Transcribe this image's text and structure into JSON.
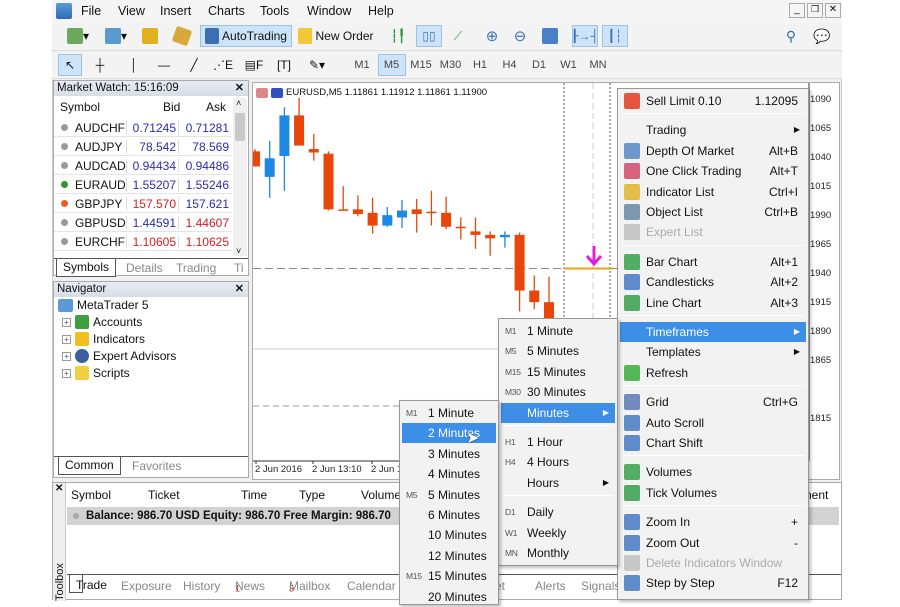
{
  "menubar": {
    "items": [
      "File",
      "View",
      "Insert",
      "Charts",
      "Tools",
      "Window",
      "Help"
    ]
  },
  "toolbar": {
    "autotrading": "AutoTrading",
    "new_order": "New Order",
    "timeframes": [
      "M1",
      "M5",
      "M15",
      "M30",
      "H1",
      "H4",
      "D1",
      "W1",
      "MN"
    ],
    "active_timeframe": "M5"
  },
  "market_watch": {
    "title": "Market Watch: 15:16:09",
    "columns": [
      "Symbol",
      "Bid",
      "Ask"
    ],
    "rows": [
      {
        "symbol": "AUDCHF",
        "bid": "0.71245",
        "ask": "0.71281",
        "bid_color": "#2b2bb0",
        "ask_color": "#2b2bb0",
        "dir": "none"
      },
      {
        "symbol": "AUDJPY",
        "bid": "78.542",
        "ask": "78.569",
        "bid_color": "#2b2bb0",
        "ask_color": "#2b2bb0",
        "dir": "none"
      },
      {
        "symbol": "AUDCAD",
        "bid": "0.94434",
        "ask": "0.94486",
        "bid_color": "#2b2bb0",
        "ask_color": "#2b2bb0",
        "dir": "none"
      },
      {
        "symbol": "EURAUD",
        "bid": "1.55207",
        "ask": "1.55246",
        "bid_color": "#2b2bb0",
        "ask_color": "#2b2bb0",
        "dir": "up"
      },
      {
        "symbol": "GBPJPY",
        "bid": "157.570",
        "ask": "157.621",
        "bid_color": "#d02020",
        "ask_color": "#2b2bb0",
        "dir": "down"
      },
      {
        "symbol": "GBPUSD",
        "bid": "1.44591",
        "ask": "1.44607",
        "bid_color": "#2b2bb0",
        "ask_color": "#d02020",
        "dir": "none"
      },
      {
        "symbol": "EURCHF",
        "bid": "1.10605",
        "ask": "1.10625",
        "bid_color": "#d02020",
        "ask_color": "#d02020",
        "dir": "none"
      }
    ],
    "tabs": [
      "Symbols",
      "Details",
      "Trading",
      "Ti"
    ]
  },
  "navigator": {
    "title": "Navigator",
    "root": "MetaTrader 5",
    "items": [
      "Accounts",
      "Indicators",
      "Expert Advisors",
      "Scripts"
    ],
    "tabs": [
      "Common",
      "Favorites"
    ]
  },
  "chart": {
    "title": "EURUSD,M5  1.11861 1.11912 1.11861 1.11900",
    "bull_color": "#1e88e5",
    "bear_color": "#e8460a",
    "price_labels": [
      "1090",
      "1065",
      "1040",
      "1015",
      "1990",
      "1965",
      "1940",
      "1915",
      "1890",
      "1865",
      "1815"
    ],
    "price_label_values": [
      1.1209,
      1.12065,
      1.1204,
      1.12015,
      1.1199,
      1.11965,
      1.1194,
      1.11915,
      1.1189,
      1.11865,
      1.11815
    ],
    "time_labels": [
      "2 Jun 2016",
      "2 Jun 13:10",
      "2 Jun 1"
    ],
    "candles": [
      [
        1.12044,
        1.12046,
        1.12031,
        1.12031
      ],
      [
        1.12022,
        1.12053,
        1.12004,
        1.12038
      ],
      [
        1.1204,
        1.12082,
        1.1201,
        1.12075
      ],
      [
        1.12075,
        1.1209,
        1.12049,
        1.12049
      ],
      [
        1.12046,
        1.12059,
        1.12036,
        1.12043
      ],
      [
        1.12042,
        1.12044,
        1.11993,
        1.11994
      ],
      [
        1.11994,
        1.12014,
        1.11993,
        1.11993
      ],
      [
        1.11994,
        1.12006,
        1.11988,
        1.1199
      ],
      [
        1.11991,
        1.12004,
        1.11973,
        1.1198
      ],
      [
        1.1198,
        1.11996,
        1.11979,
        1.11989
      ],
      [
        1.11987,
        1.12002,
        1.11978,
        1.11993
      ],
      [
        1.11994,
        1.12003,
        1.11974,
        1.1199
      ],
      [
        1.11992,
        1.1201,
        1.1198,
        1.11991
      ],
      [
        1.11991,
        1.12005,
        1.11977,
        1.11979
      ],
      [
        1.11979,
        1.11987,
        1.11968,
        1.11978
      ],
      [
        1.11975,
        1.11987,
        1.1196,
        1.11972
      ],
      [
        1.11972,
        1.11975,
        1.11954,
        1.11969
      ],
      [
        1.1197,
        1.11975,
        1.11961,
        1.11972
      ],
      [
        1.11972,
        1.11974,
        1.11906,
        1.11924
      ],
      [
        1.11924,
        1.11937,
        1.11908,
        1.11914
      ],
      [
        1.11914,
        1.11936,
        1.11893,
        1.11899
      ]
    ],
    "sell_limit_level": 1.11943
  },
  "context_menu": {
    "items": [
      {
        "label": "Sell Limit 0.10",
        "shortcut": "1.12095",
        "icon": "sell-limit-icon",
        "color": "#e03010"
      },
      {
        "sep": true
      },
      {
        "label": "Trading",
        "submenu": true
      },
      {
        "label": "Depth Of Market",
        "shortcut": "Alt+B",
        "icon": "depth-of-market-icon",
        "color": "#4a7fc0"
      },
      {
        "label": "One Click Trading",
        "shortcut": "Alt+T",
        "icon": "one-click-trading-icon",
        "color": "#d04060"
      },
      {
        "label": "Indicator List",
        "shortcut": "Ctrl+I",
        "icon": "indicator-list-icon",
        "color": "#e0b020"
      },
      {
        "label": "Object List",
        "shortcut": "Ctrl+B",
        "icon": "object-list-icon",
        "color": "#6080a0"
      },
      {
        "label": "Expert List",
        "disabled": true,
        "icon": "expert-list-icon",
        "color": "#bbb"
      },
      {
        "sep": true
      },
      {
        "label": "Bar Chart",
        "shortcut": "Alt+1",
        "icon": "bar-chart-icon",
        "color": "#2a9a40"
      },
      {
        "label": "Candlesticks",
        "shortcut": "Alt+2",
        "icon": "candlesticks-icon",
        "color": "#3a70c0"
      },
      {
        "label": "Line Chart",
        "shortcut": "Alt+3",
        "icon": "line-chart-icon",
        "color": "#2a9a40"
      },
      {
        "sep": true
      },
      {
        "label": "Timeframes",
        "submenu": true,
        "highlighted": true
      },
      {
        "label": "Templates",
        "submenu": true
      },
      {
        "label": "Refresh",
        "icon": "refresh-icon",
        "color": "#30a830"
      },
      {
        "sep": true
      },
      {
        "label": "Grid",
        "shortcut": "Ctrl+G",
        "icon": "grid-icon",
        "color": "#5070b0"
      },
      {
        "label": "Auto Scroll",
        "icon": "auto-scroll-icon",
        "color": "#3a70c0"
      },
      {
        "label": "Chart Shift",
        "icon": "chart-shift-icon",
        "color": "#3a70c0"
      },
      {
        "sep": true
      },
      {
        "label": "Volumes",
        "icon": "volumes-icon",
        "color": "#2a9a40"
      },
      {
        "label": "Tick Volumes",
        "icon": "tick-volumes-icon",
        "color": "#2a9a40"
      },
      {
        "sep": true
      },
      {
        "label": "Zoom In",
        "shortcut": "+",
        "icon": "zoom-in-icon",
        "color": "#3a70c0"
      },
      {
        "label": "Zoom Out",
        "shortcut": "-",
        "icon": "zoom-out-icon",
        "color": "#3a70c0"
      },
      {
        "label": "Delete Indicators Window",
        "disabled": true,
        "icon": "delete-indicators-icon",
        "color": "#bbb"
      },
      {
        "label": "Step by Step",
        "shortcut": "F12",
        "icon": "step-by-step-icon",
        "color": "#3a70c0"
      }
    ]
  },
  "timeframes_menu": {
    "items": [
      {
        "tag": "M1",
        "label": "1 Minute"
      },
      {
        "tag": "M5",
        "label": "5 Minutes"
      },
      {
        "tag": "M15",
        "label": "15 Minutes"
      },
      {
        "tag": "M30",
        "label": "30 Minutes"
      },
      {
        "label": "Minutes",
        "submenu": true,
        "highlighted": true
      },
      {
        "sep": true
      },
      {
        "tag": "H1",
        "label": "1 Hour"
      },
      {
        "tag": "H4",
        "label": "4 Hours"
      },
      {
        "label": "Hours",
        "submenu": true
      },
      {
        "sep": true
      },
      {
        "tag": "D1",
        "label": "Daily"
      },
      {
        "tag": "W1",
        "label": "Weekly"
      },
      {
        "tag": "MN",
        "label": "Monthly"
      }
    ]
  },
  "minutes_menu": {
    "items": [
      {
        "tag": "M1",
        "label": "1 Minute"
      },
      {
        "label": "2 Minutes",
        "highlighted": true
      },
      {
        "label": "3 Minutes"
      },
      {
        "label": "4 Minutes"
      },
      {
        "tag": "M5",
        "label": "5 Minutes"
      },
      {
        "label": "6 Minutes"
      },
      {
        "label": "10 Minutes"
      },
      {
        "label": "12 Minutes"
      },
      {
        "tag": "M15",
        "label": "15 Minutes"
      },
      {
        "label": "20 Minutes"
      }
    ]
  },
  "toolbox": {
    "label": "Toolbox",
    "columns": [
      "Symbol",
      "Ticket",
      "Time",
      "Type",
      "Volume"
    ],
    "right_column": "nent",
    "balance": "Balance: 986.70 USD  Equity: 986.70  Free Margin: 986.70",
    "tabs": [
      {
        "label": "Trade"
      },
      {
        "label": "Exposure"
      },
      {
        "label": "History"
      },
      {
        "label": "News",
        "badge": "1"
      },
      {
        "label": "Mailbox",
        "badge": "3"
      },
      {
        "label": "Calendar"
      },
      {
        "label": "ket"
      },
      {
        "label": "Alerts"
      },
      {
        "label": "Signals"
      }
    ]
  }
}
